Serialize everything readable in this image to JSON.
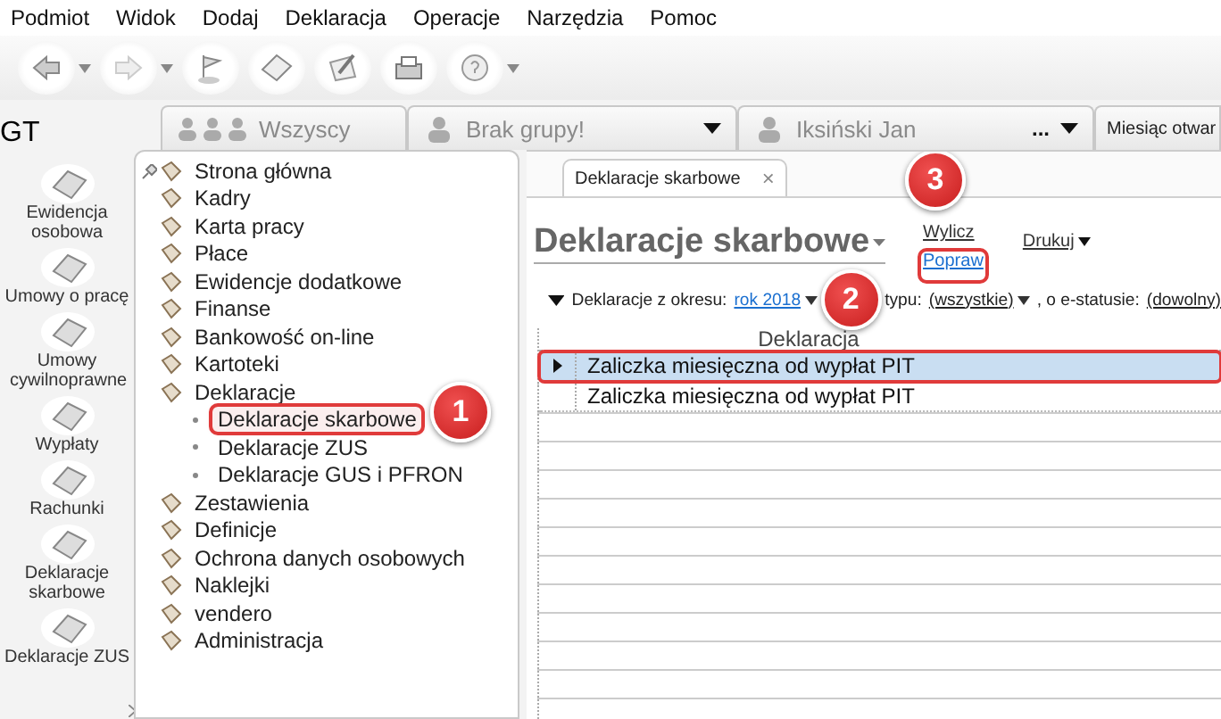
{
  "menu": [
    "Podmiot",
    "Widok",
    "Dodaj",
    "Deklaracja",
    "Operacje",
    "Narzędzia",
    "Pomoc"
  ],
  "logo": "GT",
  "context_tabs": [
    {
      "label": "Wszyscy",
      "dropdown": false
    },
    {
      "label": "Brak grupy!",
      "dropdown": true
    },
    {
      "label": "Iksiński Jan",
      "dropdown": true,
      "more": "..."
    },
    {
      "label": "Miesiąc otwar"
    }
  ],
  "modules": [
    "Ewidencja osobowa",
    "Umowy o pracę",
    "Umowy cywilnoprawne",
    "Wypłaty",
    "Rachunki",
    "Deklaracje skarbowe",
    "Deklaracje ZUS"
  ],
  "tree": [
    {
      "label": "Strona główna"
    },
    {
      "label": "Kadry"
    },
    {
      "label": "Karta pracy"
    },
    {
      "label": "Płace"
    },
    {
      "label": "Ewidencje dodatkowe"
    },
    {
      "label": "Finanse"
    },
    {
      "label": "Bankowość on-line"
    },
    {
      "label": "Kartoteki"
    },
    {
      "label": "Deklaracje",
      "expanded": true,
      "children": [
        {
          "label": "Deklaracje skarbowe",
          "selected": true,
          "annotated": true
        },
        {
          "label": "Deklaracje ZUS",
          "selected": false,
          "annotated": false
        },
        {
          "label": "Deklaracje GUS i PFRON",
          "selected": false,
          "annotated": false
        }
      ]
    },
    {
      "label": "Zestawienia"
    },
    {
      "label": "Definicje"
    },
    {
      "label": "Ochrona danych osobowych"
    },
    {
      "label": "Naklejki"
    },
    {
      "label": "vendero"
    },
    {
      "label": "Administracja"
    }
  ],
  "document_tab": {
    "label": "Deklaracje skarbowe",
    "close": "×"
  },
  "page_title": "Deklaracje skarbowe",
  "actions": [
    {
      "label": "Wylicz",
      "kind": "plain",
      "annotated": false
    },
    {
      "label": "Popraw",
      "kind": "link",
      "annotated": true
    },
    {
      "label": "Drukuj",
      "kind": "menu",
      "annotated": false
    }
  ],
  "filter": {
    "label": "Deklaracje z okresu:",
    "period": "rok 2018",
    "type_label": "typu:",
    "type": "(wszystkie)",
    "status_label": ", o e-statusie:",
    "status": "(dowolny)"
  },
  "table": {
    "columns": [
      "Deklaracja"
    ],
    "rows": [
      {
        "cells": [
          "Zaliczka miesięczna od wypłat PIT"
        ],
        "selected": true,
        "annotated": true
      },
      {
        "cells": [
          "Zaliczka miesięczna od wypłat PIT"
        ],
        "selected": false,
        "annotated": false
      }
    ]
  },
  "callouts": [
    {
      "number": "1"
    },
    {
      "number": "2"
    },
    {
      "number": "3"
    }
  ]
}
